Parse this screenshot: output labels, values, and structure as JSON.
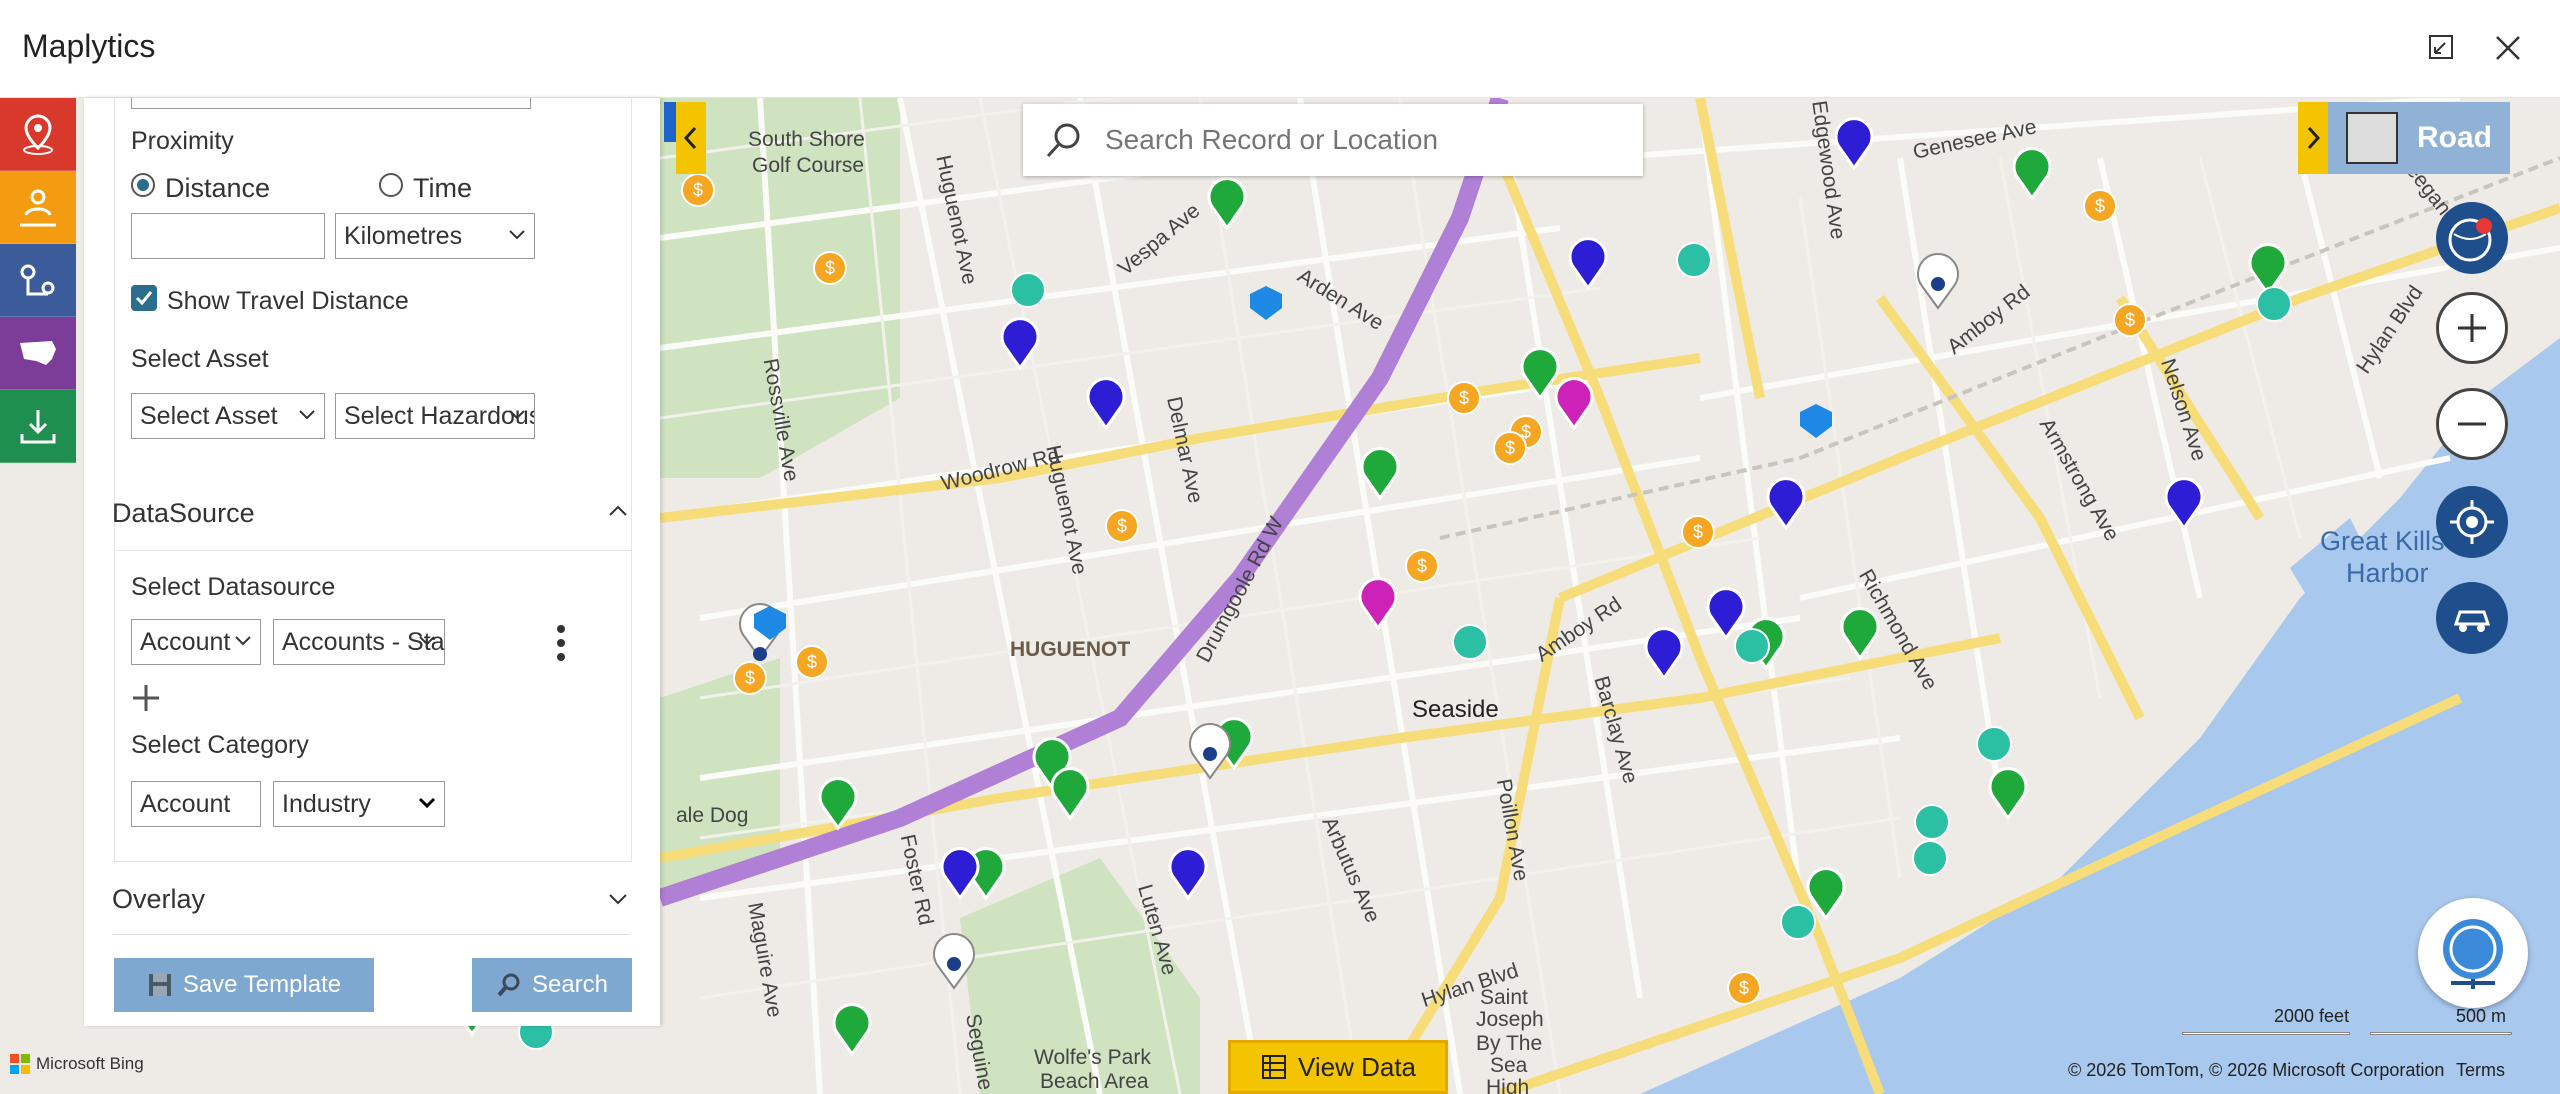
{
  "app": {
    "title": "Maplytics"
  },
  "window": {
    "restore_icon": "restore-icon",
    "close_icon": "close-icon"
  },
  "rail": [
    {
      "icon": "location-pin-icon",
      "color": "#d9382c"
    },
    {
      "icon": "territory-people-icon",
      "color": "#f39c12"
    },
    {
      "icon": "route-icon",
      "color": "#3b5b9a"
    },
    {
      "icon": "usa-map-icon",
      "color": "#7b3d98"
    },
    {
      "icon": "download-icon",
      "color": "#1e8f4e"
    }
  ],
  "panel": {
    "proximity_label": "Proximity",
    "distance_label": "Distance",
    "time_label": "Time",
    "distance_value": "",
    "unit": "Kilometres",
    "show_travel_distance": "Show Travel Distance",
    "select_asset_label": "Select Asset",
    "asset_select": "Select Asset",
    "hazard_select": "Select Hazardous",
    "datasource_header": "DataSource",
    "select_datasource_label": "Select Datasource",
    "entity_select": "Account",
    "view_select": "Accounts - Sta",
    "select_category_label": "Select Category",
    "category_entity": "Account",
    "category_field": "Industry",
    "overlay_header": "Overlay",
    "save_template": "Save Template",
    "search": "Search"
  },
  "map": {
    "search_placeholder": "Search Record or Location",
    "road_label": "Road",
    "view_data": "View Data",
    "scale_feet": "2000 feet",
    "scale_m": "500 m",
    "copyright": "© 2026 TomTom, © 2026 Microsoft Corporation",
    "terms": "Terms",
    "bing": "Microsoft Bing",
    "labels": {
      "south_shore": "South Shore",
      "golf_course": "Golf Course",
      "genesee": "Genesee Ave",
      "huguenot_ave": "Huguenot Ave",
      "vespa": "Vespa Ave",
      "arden": "Arden Ave",
      "amboy_rd": "Amboy Rd",
      "rossville": "Rossville Ave",
      "woodrow": "Woodrow Rd",
      "huguenot_ave2": "Huguenot Ave",
      "delmar": "Delmar Ave",
      "drumgoole": "Drumgoole Rd W",
      "huguenot": "HUGUENOT",
      "seaside": "Seaside",
      "amboy_rd2": "Amboy Rd",
      "barclay": "Barclay Ave",
      "richmond": "Richmond Ave",
      "armstrong": "Armstrong Ave",
      "nelson": "Nelson Ave",
      "hylan": "Hylan Blvd",
      "hylan2": "Hylan Blvd",
      "keegans": "Keegans Ln",
      "great_kills": "Great Kills",
      "harbor": "Harbor",
      "edgewood": "Edgewood Ave",
      "ale_dog": "ale Dog",
      "foster": "Foster Rd",
      "luten": "Luten Ave",
      "arbutus": "Arbutus Ave",
      "poillon": "Poillon Ave",
      "maguire": "Maguire Ave",
      "seguine": "Seguine",
      "wolfes1": "Wolfe's Park",
      "wolfes2": "Beach Area",
      "saint1": "Saint",
      "saint2": "Joseph",
      "saint3": "By The",
      "saint4": "Sea",
      "saint5": "High"
    }
  }
}
